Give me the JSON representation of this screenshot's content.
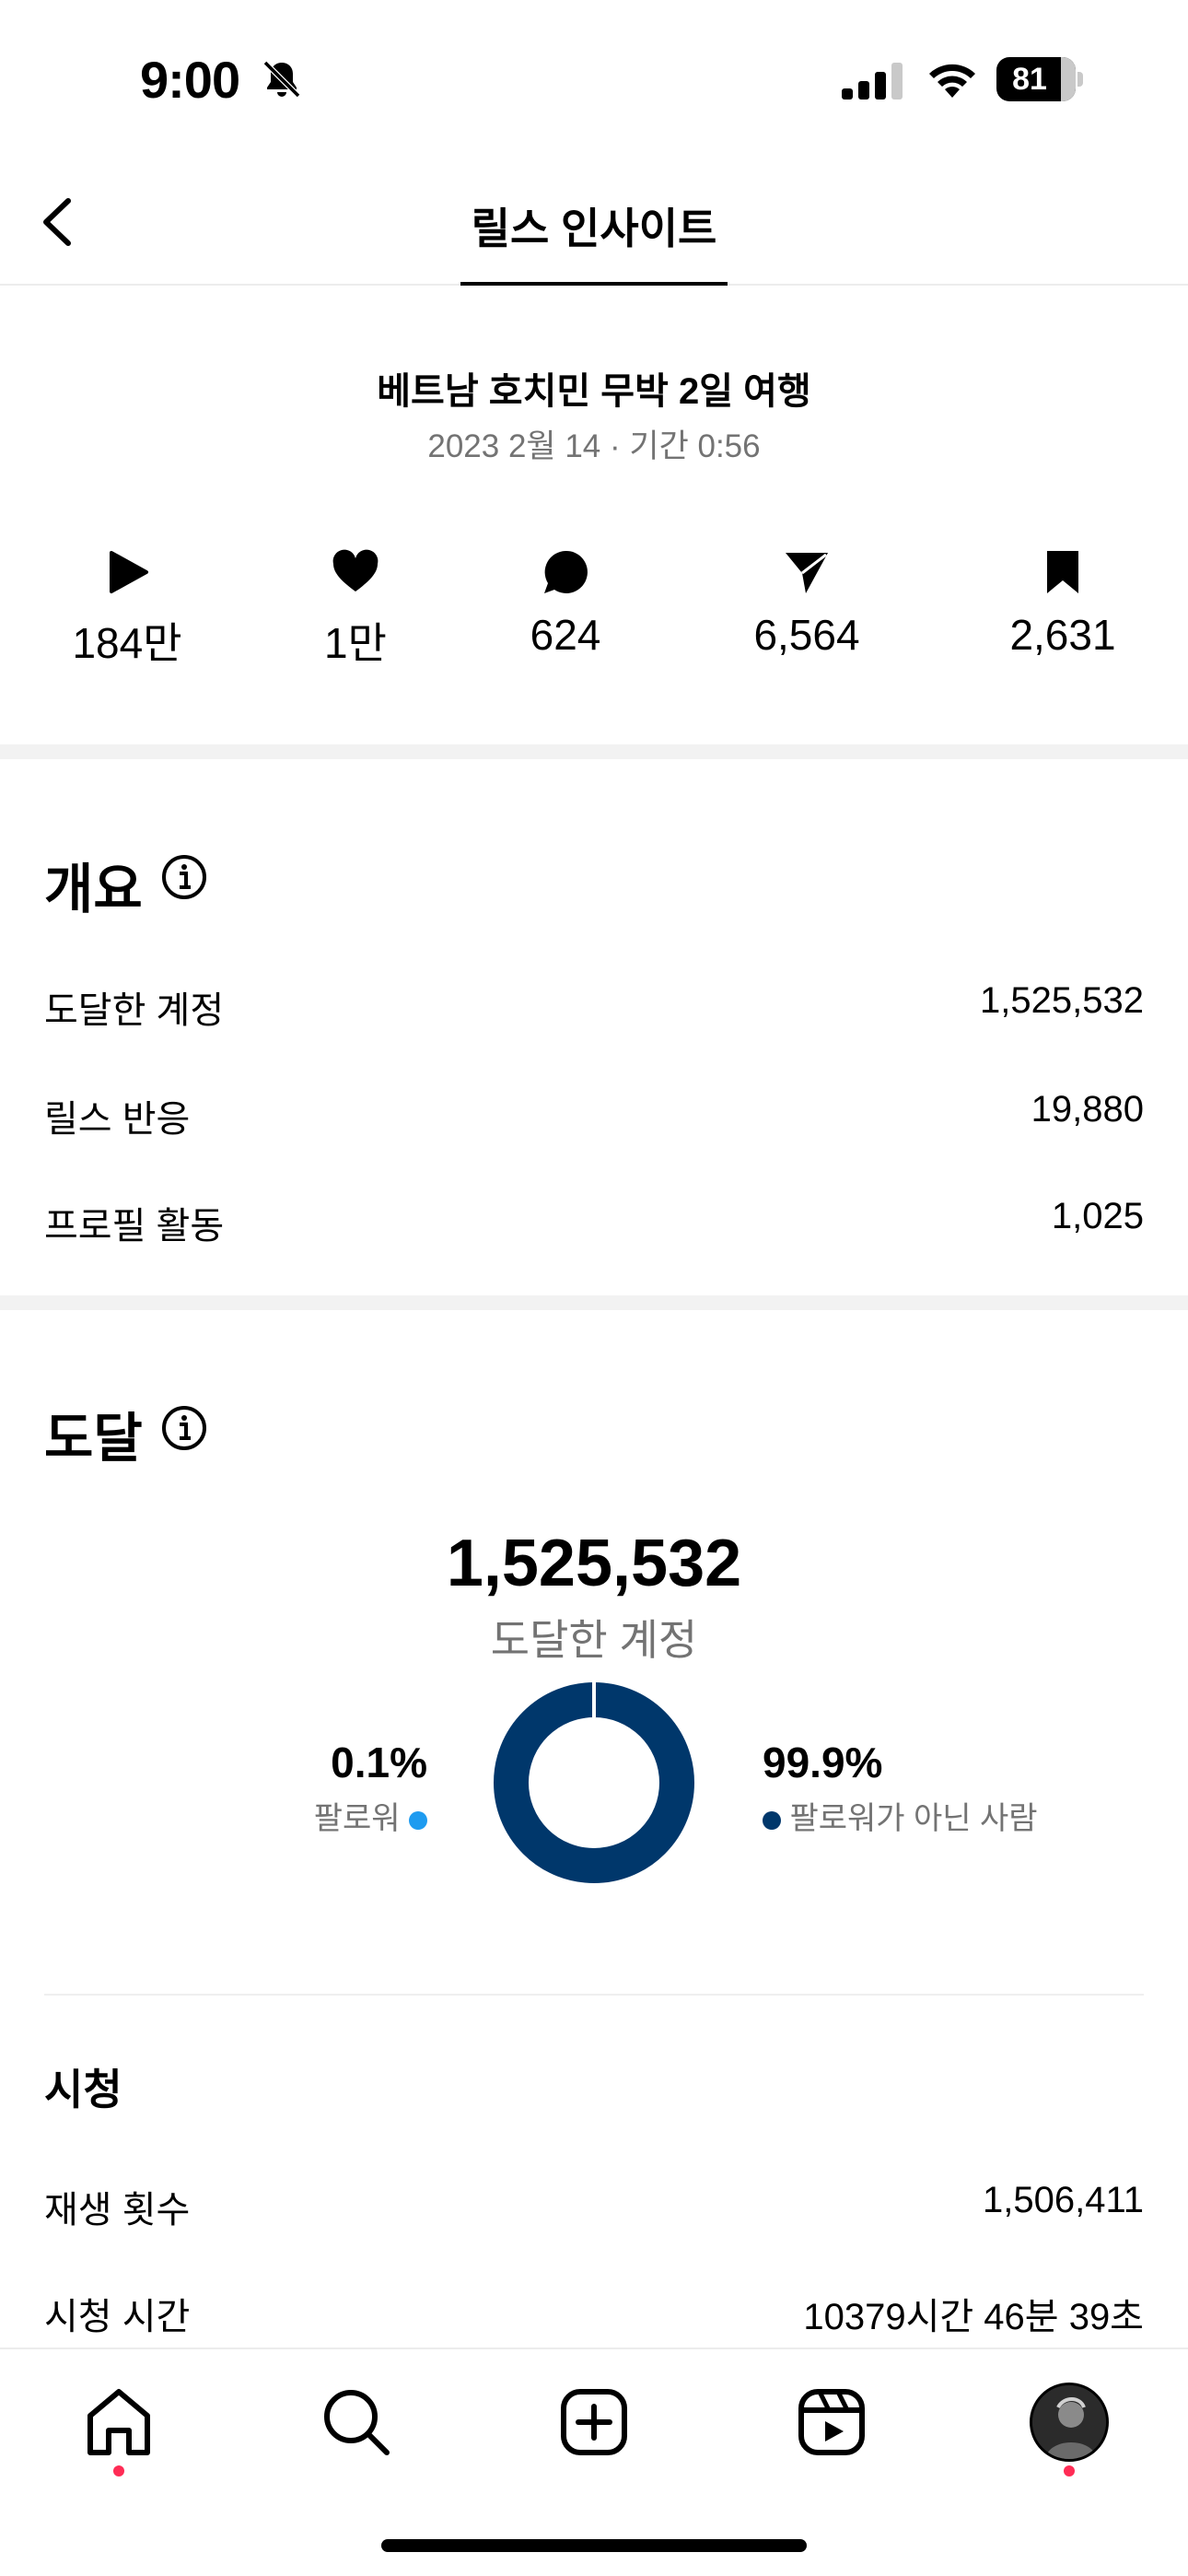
{
  "status_bar": {
    "time": "9:00",
    "battery": "81"
  },
  "header": {
    "title": "릴스 인사이트"
  },
  "reel": {
    "title": "베트남 호치민 무박 2일 여행",
    "meta": "2023 2월 14 · 기간 0:56"
  },
  "stats": [
    {
      "icon": "play-icon",
      "value": "184만"
    },
    {
      "icon": "heart-icon",
      "value": "1만"
    },
    {
      "icon": "comment-icon",
      "value": "624"
    },
    {
      "icon": "share-icon",
      "value": "6,564"
    },
    {
      "icon": "bookmark-icon",
      "value": "2,631"
    }
  ],
  "overview": {
    "heading": "개요",
    "rows": [
      {
        "label": "도달한 계정",
        "value": "1,525,532"
      },
      {
        "label": "릴스 반응",
        "value": "19,880"
      },
      {
        "label": "프로필 활동",
        "value": "1,025"
      }
    ]
  },
  "reach": {
    "heading": "도달",
    "total": "1,525,532",
    "total_label": "도달한 계정",
    "followers_pct": "0.1%",
    "followers_label": "팔로워",
    "non_followers_pct": "99.9%",
    "non_followers_label": "팔로워가 아닌 사람",
    "followers_fraction": 0.001,
    "colors": {
      "followers": "#1e9bf0",
      "non_followers": "#00376b"
    }
  },
  "viewing": {
    "heading": "시청",
    "rows": [
      {
        "label": "재생 횟수",
        "value": "1,506,411"
      },
      {
        "label": "시청 시간",
        "value": "10379시간 46분 39초"
      }
    ]
  },
  "tab_bar": {
    "items": [
      "home-icon",
      "search-icon",
      "create-icon",
      "reels-icon",
      "profile-avatar"
    ],
    "notification_color": "#ff2c55"
  }
}
